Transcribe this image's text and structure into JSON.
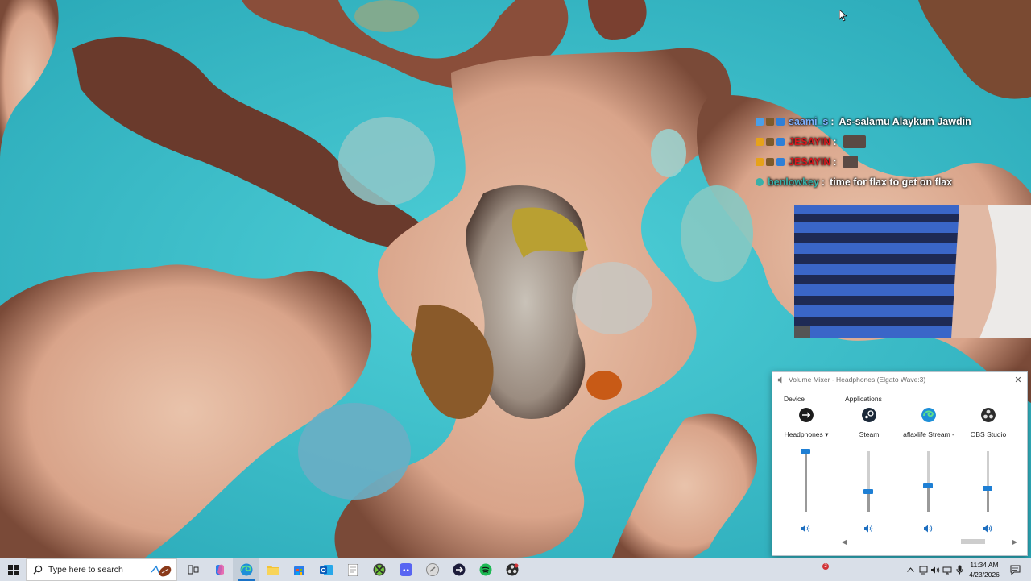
{
  "chat": {
    "messages": [
      {
        "user": "saami_s",
        "user_color": "#7fb0ff",
        "text": "As-salamu Alaykum Jawdin",
        "badges": [
          "#4a9fe8",
          "#7e5a2a",
          "#2f7fd6"
        ],
        "emote": false
      },
      {
        "user": "JESAYIN",
        "user_color": "#d8191f",
        "text": "",
        "badges": [
          "#e6a21a",
          "#7e5a2a",
          "#2f7fd6"
        ],
        "emote": true
      },
      {
        "user": "JESAYIN",
        "user_color": "#d8191f",
        "text": "",
        "badges": [
          "#e6a21a",
          "#7e5a2a",
          "#2f7fd6"
        ],
        "emote": true
      },
      {
        "user": "benlowkey",
        "user_color": "#39b0a8",
        "text": "time for flax to get on flax",
        "badges": [
          "#39b0a8"
        ],
        "emote": false
      }
    ]
  },
  "mixer": {
    "title": "Volume Mixer - Headphones (Elgato Wave:3)",
    "device_label": "Device",
    "applications_label": "Applications",
    "columns": [
      {
        "name": "Headphones ▾",
        "icon": "headphones-device-icon",
        "color": "#1d1d1d",
        "level": 1.0
      },
      {
        "name": "Steam",
        "icon": "steam-icon",
        "color": "#1b2838",
        "level": 0.35
      },
      {
        "name": "aflaxlife Stream -",
        "icon": "edge-icon",
        "color": "#1d8fd8",
        "level": 0.45
      },
      {
        "name": "OBS Studio",
        "icon": "obs-icon",
        "color": "#2b2b2b",
        "level": 0.4
      }
    ]
  },
  "taskbar": {
    "search_placeholder": "Type here to search",
    "apps": [
      "task-view",
      "copilot",
      "edge",
      "file-explorer",
      "microsoft-store",
      "outlook",
      "notepad",
      "xbox",
      "discord",
      "app-circle",
      "elgato",
      "spotify",
      "obs"
    ],
    "notification_count": "2",
    "time": "11:34 AM",
    "date": "4/23/2026"
  }
}
